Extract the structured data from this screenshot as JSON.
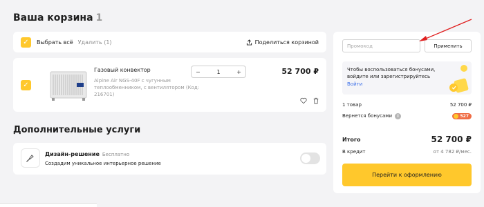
{
  "cart": {
    "title": "Ваша корзина",
    "count": "1"
  },
  "toolbar": {
    "select_all": "Выбрать всё",
    "delete": "Удалить (1)",
    "share": "Поделиться корзиной"
  },
  "product": {
    "name": "Газовый конвектор",
    "description": "Alpine Air NGS-40F с чугунным теплообменником, с вентилятором (Код: 216701)",
    "quantity": "1",
    "price": "52 700 ₽"
  },
  "services": {
    "title": "Дополнительные услуги",
    "design": {
      "title": "Дизайн-решение",
      "badge": "Бесплатно",
      "description": "Создадим уникальное интерьерное решение",
      "enabled": false
    }
  },
  "summary": {
    "promo_placeholder": "Промокод",
    "apply": "Применить",
    "bonus_text": "Чтобы воспользоваться бонусами, войдите или зарегистрируйтесь",
    "login_link": "Войти",
    "items_label": "1 товар",
    "items_value": "52 700 ₽",
    "bonus_label": "Вернется бонусами",
    "bonus_value": "527",
    "total_label": "Итого",
    "total_value": "52 700 ₽",
    "credit_label": "В кредит",
    "credit_value": "от 4 782 ₽/мес.",
    "checkout": "Перейти к оформлению"
  },
  "colors": {
    "accent": "#ffc82c",
    "link": "#3a6ee8",
    "bonus_badge": "#f06d45",
    "arrow": "#e02020"
  },
  "icons": [
    "check-icon",
    "share-icon",
    "minus-icon",
    "plus-icon",
    "heart-icon",
    "trash-icon",
    "design-icon",
    "info-icon",
    "coin-icon"
  ]
}
